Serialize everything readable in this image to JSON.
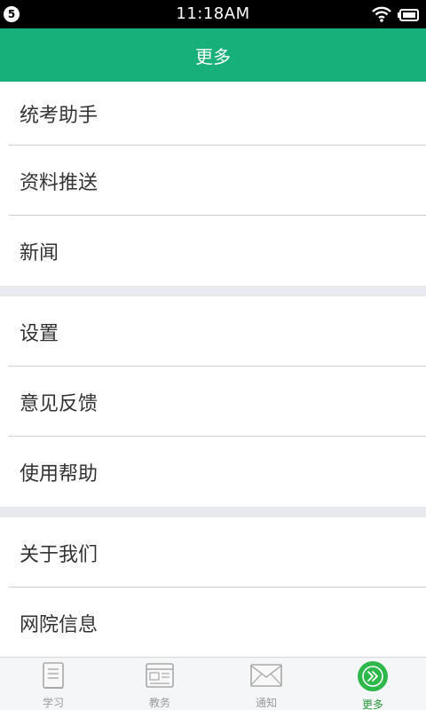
{
  "status_bar": {
    "notification_count": "5",
    "time": "11:18AM"
  },
  "header": {
    "title": "更多"
  },
  "menu": {
    "groups": [
      {
        "items": [
          {
            "label": "统考助手"
          },
          {
            "label": "资料推送"
          },
          {
            "label": "新闻"
          }
        ]
      },
      {
        "items": [
          {
            "label": "设置"
          },
          {
            "label": "意见反馈"
          },
          {
            "label": "使用帮助"
          }
        ]
      },
      {
        "items": [
          {
            "label": "关于我们"
          },
          {
            "label": "网院信息"
          }
        ]
      }
    ]
  },
  "tabbar": {
    "active_color": "#2a9a3a",
    "tabs": [
      {
        "label": "学习",
        "icon": "book-icon"
      },
      {
        "label": "教务",
        "icon": "newspaper-icon"
      },
      {
        "label": "通知",
        "icon": "envelope-icon"
      },
      {
        "label": "更多",
        "icon": "more-icon"
      }
    ]
  },
  "colors": {
    "header": "#18b07a",
    "divider": "#cfcfcf",
    "group_gap": "#e8e9ee"
  }
}
